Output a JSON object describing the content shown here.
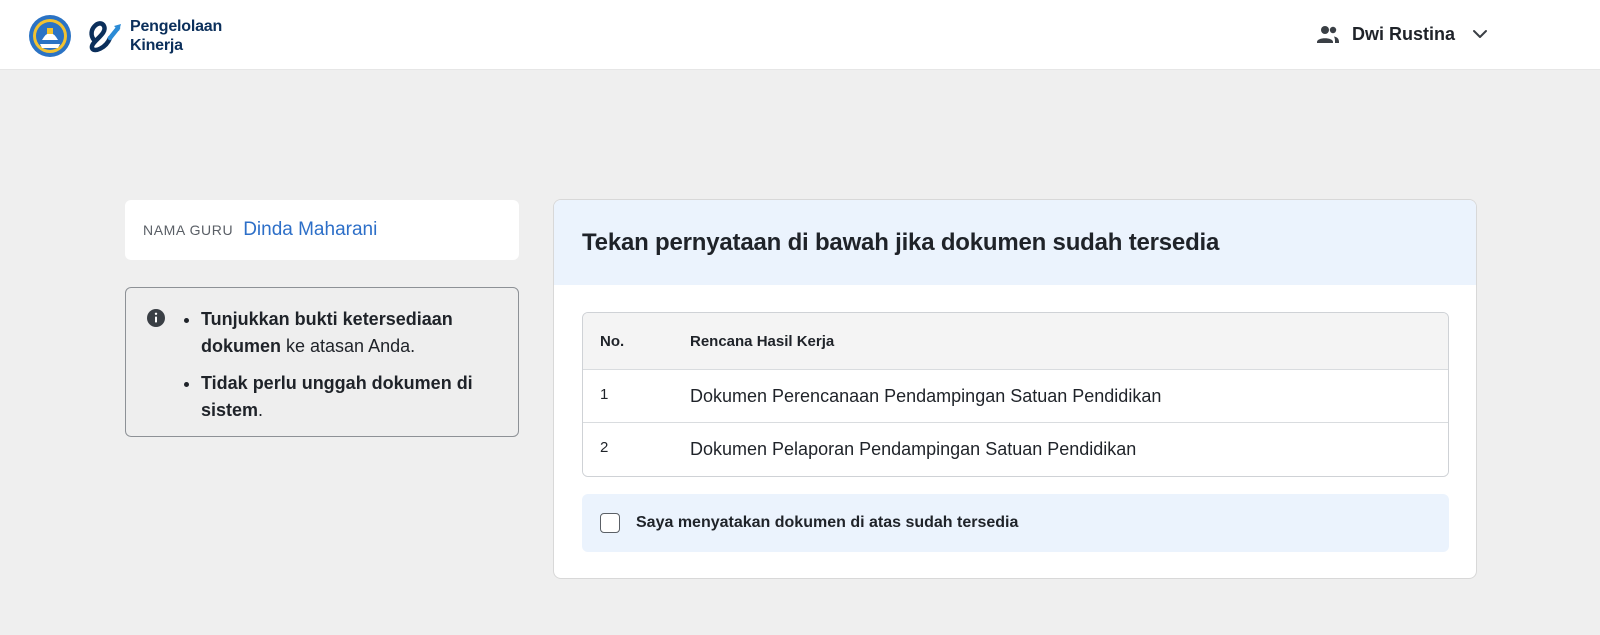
{
  "header": {
    "app_name_line1": "Pengelolaan",
    "app_name_line2": "Kinerja",
    "user_name": "Dwi Rustina"
  },
  "teacher": {
    "label": "NAMA GURU",
    "name": "Dinda Maharani"
  },
  "info": {
    "items": [
      {
        "bold": "Tunjukkan bukti ketersediaan dokumen",
        "rest": " ke atasan Anda."
      },
      {
        "bold": "Tidak perlu unggah dokumen di sistem",
        "rest": "."
      }
    ]
  },
  "main": {
    "title": "Tekan pernyataan di bawah jika dokumen sudah tersedia",
    "table": {
      "headers": [
        "No.",
        "Rencana Hasil Kerja"
      ],
      "rows": [
        [
          "1",
          "Dokumen Perencanaan Pendampingan Satuan Pendidikan"
        ],
        [
          "2",
          "Dokumen Pelaporan Pendampingan Satuan Pendidikan"
        ]
      ]
    },
    "confirm": {
      "label": "Saya menyatakan dokumen di atas sudah tersedia",
      "checked": false
    }
  },
  "colors": {
    "accent_blue": "#2d6fc8",
    "panel_blue": "#ebf3fd",
    "brand_navy": "#0b2f5b"
  },
  "icons": [
    "emblem-logo-icon",
    "e-kinerja-logo-icon",
    "users-icon",
    "chevron-down-icon",
    "info-icon",
    "checkbox-icon"
  ]
}
